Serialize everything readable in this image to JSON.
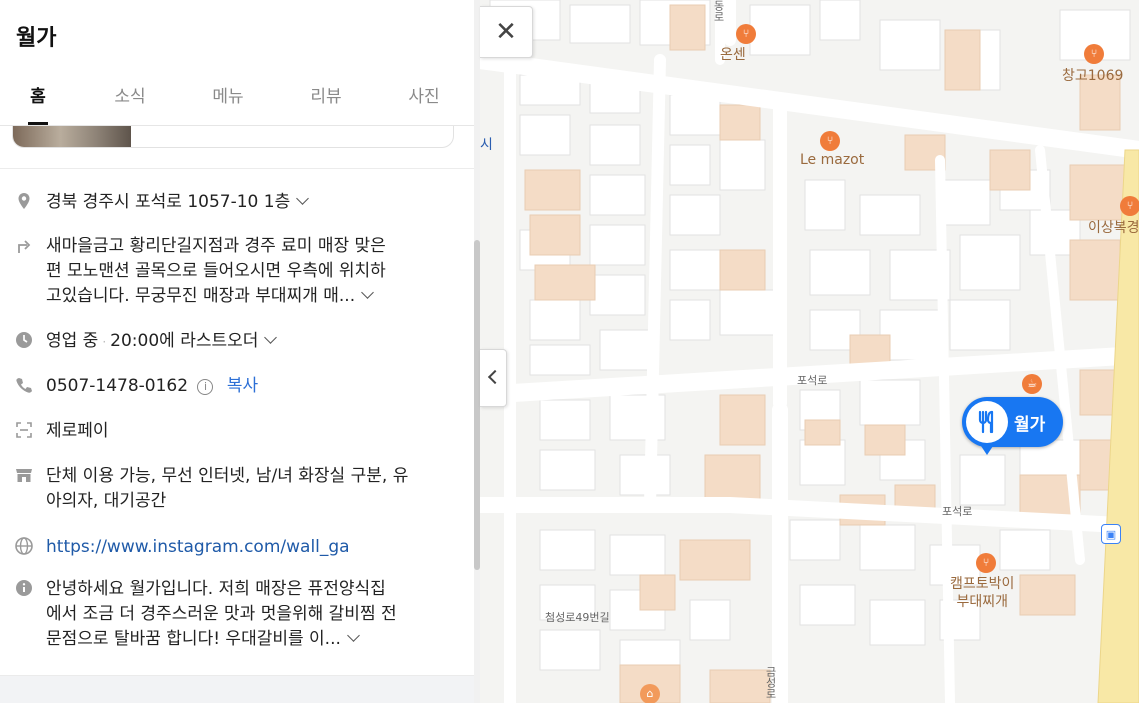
{
  "place": {
    "title": "월가"
  },
  "tabs": [
    {
      "label": "홈",
      "active": true
    },
    {
      "label": "소식",
      "active": false
    },
    {
      "label": "메뉴",
      "active": false
    },
    {
      "label": "리뷰",
      "active": false
    },
    {
      "label": "사진",
      "active": false
    }
  ],
  "info": {
    "address": "경북 경주시 포석로 1057-10 1층",
    "directions": [
      "새마을금고 황리단길지점과 경주 료미 매장 맞은",
      "편 모노맨션 골목으로 들어오시면 우측에 위치하",
      "고있습니다. 무궁무진 매장과 부대찌개 매..."
    ],
    "hours_status": "영업 중",
    "hours_detail": "20:00에 라스트오더",
    "phone": "0507-1478-0162",
    "phone_info_glyph": "i",
    "copy_label": "복사",
    "payment": "제로페이",
    "amenities": [
      "단체 이용 가능, 무선 인터넷, 남/녀 화장실 구분, 유",
      "아의자, 대기공간"
    ],
    "website": "https://www.instagram.com/wall_ga",
    "description": [
      "안녕하세요 월가입니다. 저희 매장은 퓨전양식집",
      "에서 조금 더 경주스러운 맛과 멋을위해 갈비찜 전",
      "문점으로 탈바꿈 합니다! 우대갈비를 이..."
    ]
  },
  "icons": {
    "address": "location-pin-icon",
    "directions": "directions-arrow-icon",
    "hours": "clock-icon",
    "phone": "phone-icon",
    "payment": "scan-frame-icon",
    "amenities": "store-icon",
    "website": "globe-icon",
    "description": "info-icon"
  },
  "map": {
    "close_glyph": "✕",
    "marker_label": "월가",
    "pois": [
      {
        "name": "온센"
      },
      {
        "name": "창고1069"
      },
      {
        "name": "Le mazot"
      },
      {
        "name": "이상복경"
      },
      {
        "name": "캠프토박이\n부대찌개"
      }
    ],
    "roads": [
      "포석로",
      "포석로",
      "첨성로49번길",
      "금성로",
      "시",
      "동로"
    ]
  },
  "colors": {
    "accent": "#1877f2",
    "link": "#1f5aa8",
    "poi": "#f07c3a",
    "poi_label": "#9a6a3e",
    "building": "#ffffff",
    "building_tan": "#f4dcc6",
    "main_road": "#f8e8a6"
  }
}
